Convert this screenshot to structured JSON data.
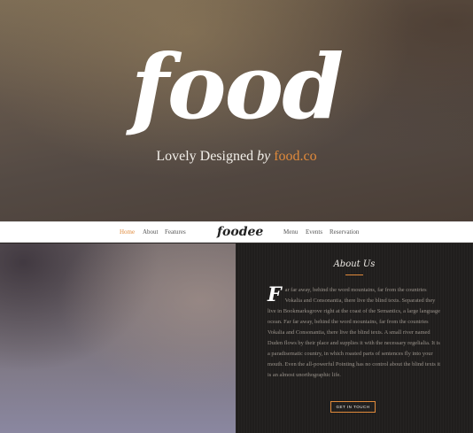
{
  "hero": {
    "title": "food",
    "tagline_main": "Lovely Designed ",
    "tagline_by": "by",
    "tagline_brand": "food.co"
  },
  "nav": {
    "left_links": [
      "Home",
      "About",
      "Features"
    ],
    "logo": "foodee",
    "right_links": [
      "Menu",
      "Events",
      "Reservation"
    ],
    "active": "Home"
  },
  "about": {
    "title": "About Us",
    "dropcap": "F",
    "body": "ar far away, behind the word mountains, far from the countries Vokalia and Consonantia, there live the blind texts. Separated they live in Bookmarksgrove right at the coast of the Semantics, a large language ocean. Far far away, behind the word mountains, far from the countries Vokalia and Consonantia, there live the blind texts. A small river named Duden flows by their place and supplies it with the necessary regelialia. It is a paradisematic country, in which roasted parts of sentences fly into your mouth. Even the all-powerful Pointing has no control about the blind texts it is an almost unorthographic life.",
    "button": "GET IN TOUCH"
  },
  "colors": {
    "accent": "#e08a3b",
    "about_bg": "#201e1d"
  }
}
